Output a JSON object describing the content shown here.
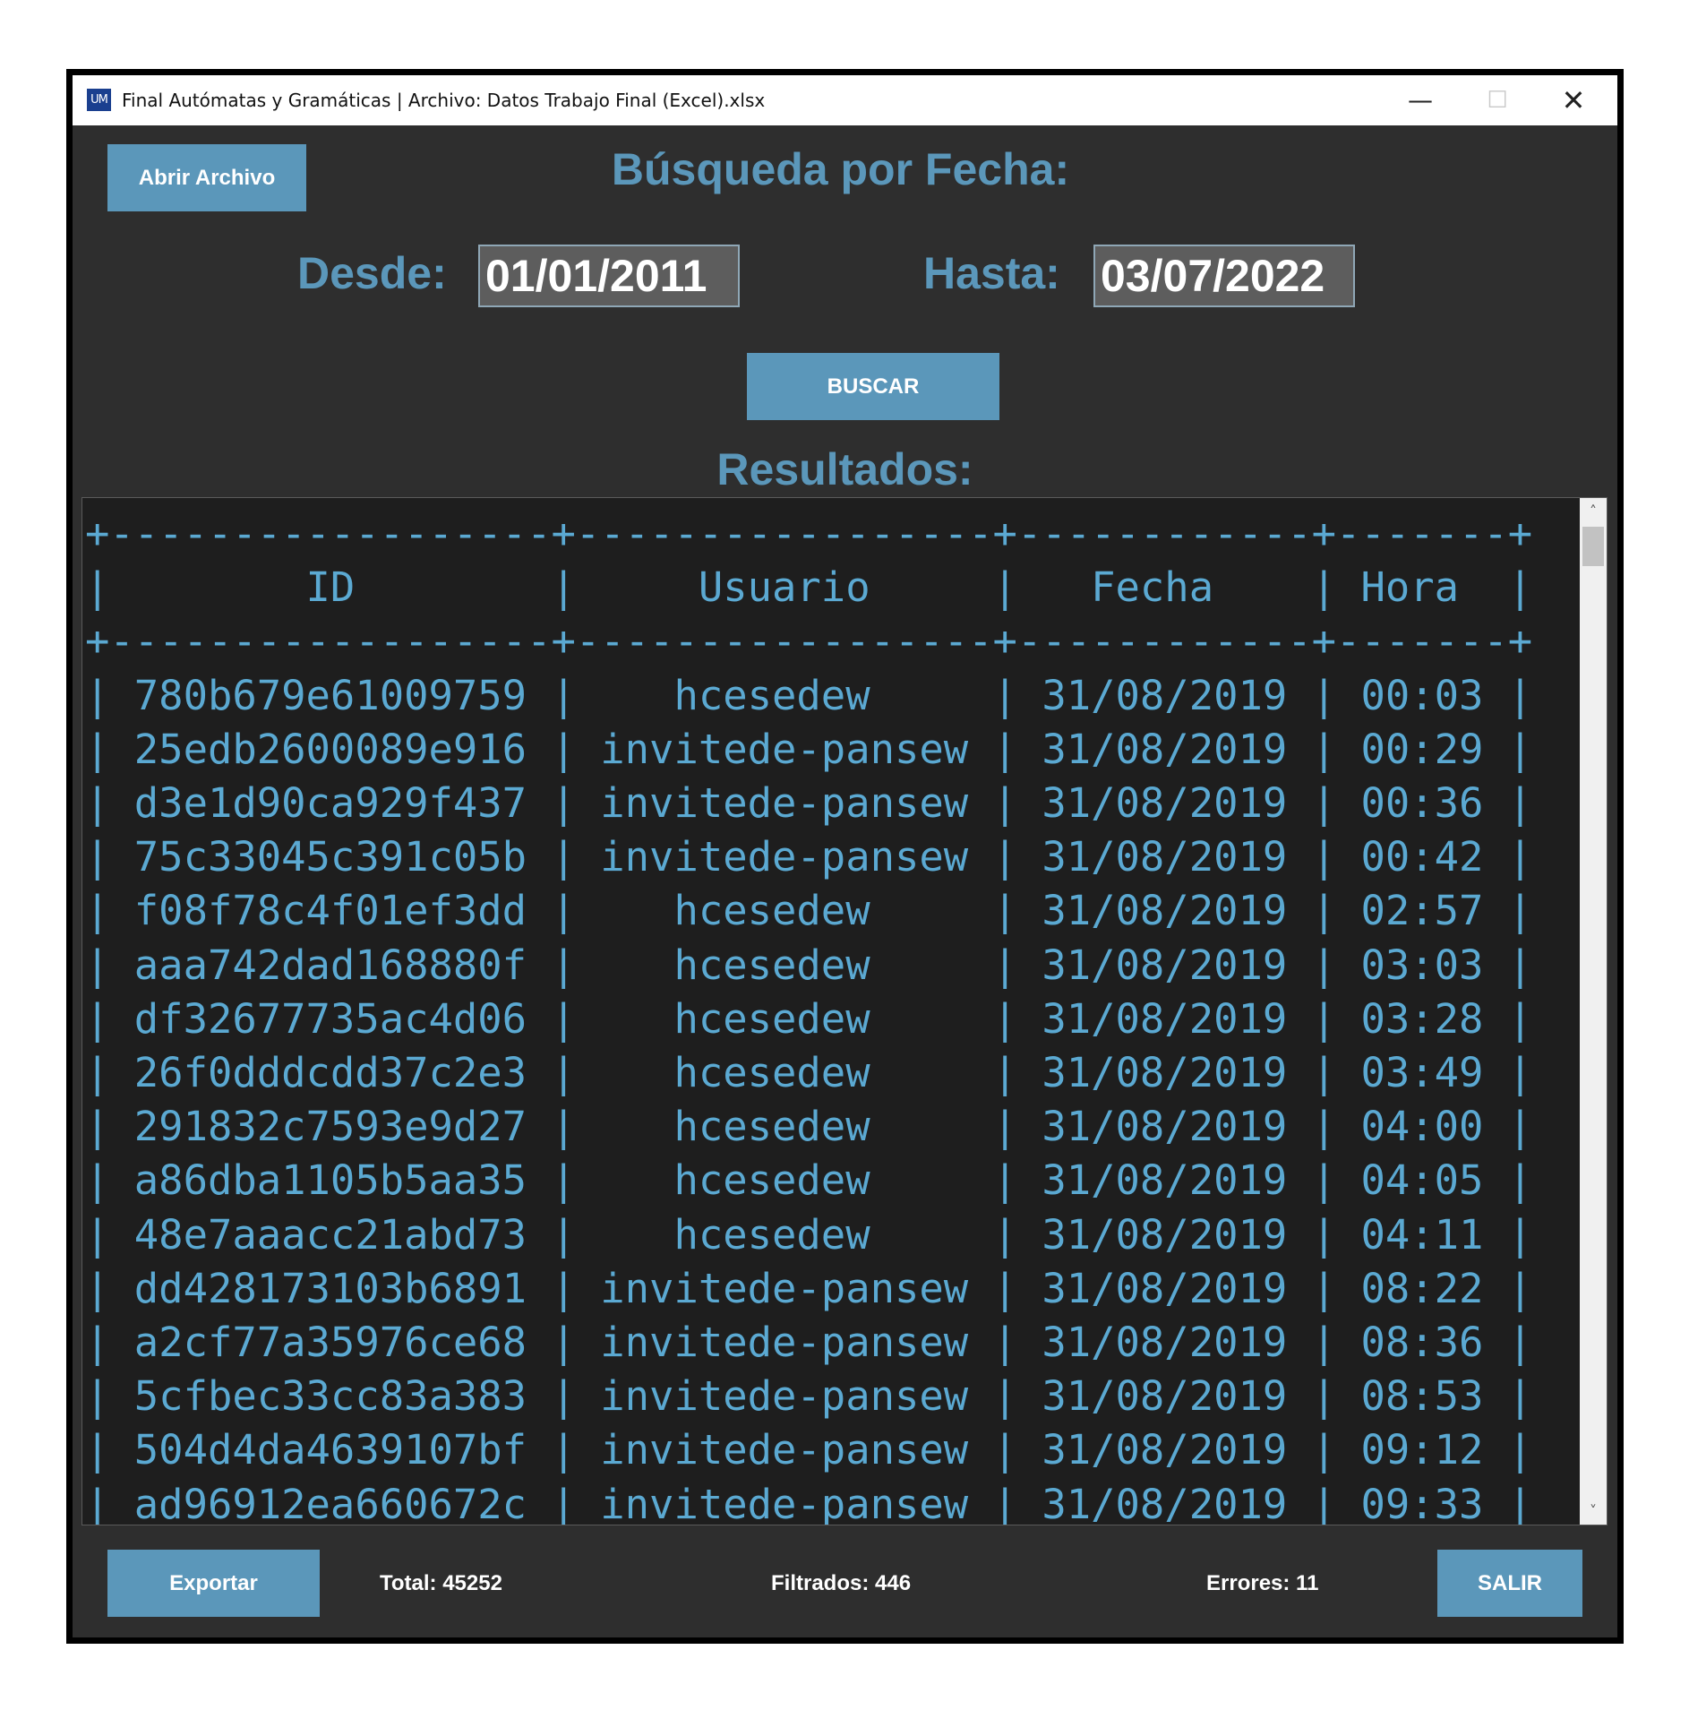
{
  "window": {
    "title": "Final Autómatas y Gramáticas | Archivo: Datos Trabajo Final (Excel).xlsx",
    "app_icon_text": "UM",
    "minimize_glyph": "—",
    "maximize_glyph": "☐",
    "close_glyph": "✕"
  },
  "toolbar": {
    "open_file_label": "Abrir Archivo"
  },
  "search": {
    "title": "Búsqueda por Fecha:",
    "from_label": "Desde:",
    "from_value": "01/01/2011",
    "to_label": "Hasta:",
    "to_value": "03/07/2022",
    "button_label": "BUSCAR"
  },
  "results": {
    "title": "Resultados:",
    "columns": [
      "ID",
      "Usuario",
      "Fecha",
      "Hora"
    ],
    "rows": [
      [
        "780b679e61009759",
        "hcesedew",
        "31/08/2019",
        "00:03"
      ],
      [
        "25edb2600089e916",
        "invitede-pansew",
        "31/08/2019",
        "00:29"
      ],
      [
        "d3e1d90ca929f437",
        "invitede-pansew",
        "31/08/2019",
        "00:36"
      ],
      [
        "75c33045c391c05b",
        "invitede-pansew",
        "31/08/2019",
        "00:42"
      ],
      [
        "f08f78c4f01ef3dd",
        "hcesedew",
        "31/08/2019",
        "02:57"
      ],
      [
        "aaa742dad168880f",
        "hcesedew",
        "31/08/2019",
        "03:03"
      ],
      [
        "df32677735ac4d06",
        "hcesedew",
        "31/08/2019",
        "03:28"
      ],
      [
        "26f0dddcdd37c2e3",
        "hcesedew",
        "31/08/2019",
        "03:49"
      ],
      [
        "291832c7593e9d27",
        "hcesedew",
        "31/08/2019",
        "04:00"
      ],
      [
        "a86dba1105b5aa35",
        "hcesedew",
        "31/08/2019",
        "04:05"
      ],
      [
        "48e7aaacc21abd73",
        "hcesedew",
        "31/08/2019",
        "04:11"
      ],
      [
        "dd428173103b6891",
        "invitede-pansew",
        "31/08/2019",
        "08:22"
      ],
      [
        "a2cf77a35976ce68",
        "invitede-pansew",
        "31/08/2019",
        "08:36"
      ],
      [
        "5cfbec33cc83a383",
        "invitede-pansew",
        "31/08/2019",
        "08:53"
      ],
      [
        "504d4da4639107bf",
        "invitede-pansew",
        "31/08/2019",
        "09:12"
      ],
      [
        "ad96912ea660672c",
        "invitede-pansew",
        "31/08/2019",
        "09:33"
      ]
    ]
  },
  "footer": {
    "export_label": "Exportar",
    "total_label": "Total: 45252",
    "filtered_label": "Filtrados: 446",
    "errors_label": "Errores: 11",
    "exit_label": "SALIR"
  },
  "colors": {
    "accent": "#5b97ba",
    "background": "#2e2e2e",
    "table_background": "#1e1e1e",
    "table_text": "#5ba9d2"
  }
}
